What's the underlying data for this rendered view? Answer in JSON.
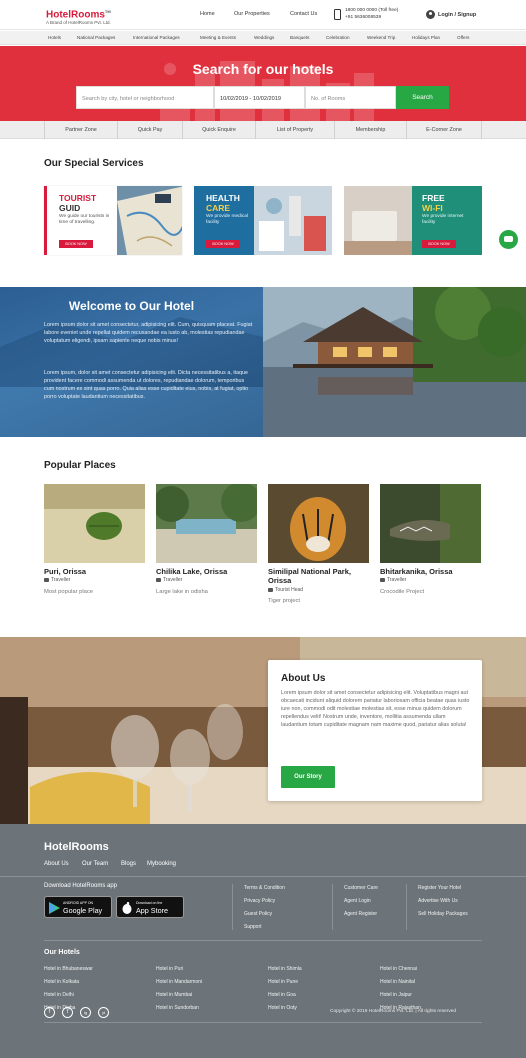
{
  "header": {
    "logo_title": "HotelRooms",
    "logo_tm": "TM",
    "logo_sub": "A Brand of HotelRooms Pvt. Ltd.",
    "nav": [
      "Home",
      "Our Properties",
      "Contact Us"
    ],
    "phone_line1": "1800 000 0000 (Toll free)",
    "phone_line2": "+91 5636008539",
    "login": "Login / Signup"
  },
  "subnav": [
    "Hotels",
    "National Packages",
    "International Packages",
    "Meeting & Events",
    "Weddings",
    "Banquets",
    "Celebration",
    "Weekend Trip",
    "Holidays Plan",
    "Offers"
  ],
  "hero": {
    "title": "Search for our hotels",
    "search_placeholder": "Search by city, hotel or neighborhood",
    "dates": "10/02/2019 - 10/02/2019",
    "rooms_placeholder": "No. of Rooms",
    "search_button": "Search",
    "accent": "#e0303e"
  },
  "quick_links": [
    "Partner Zone",
    "Quick Pay",
    "Quick Enquire",
    "List of Property",
    "Membership",
    "E-Corner Zone"
  ],
  "services": {
    "title": "Our Special Services",
    "cards": [
      {
        "title1": "TOURIST",
        "title2": "GUID",
        "desc": "We guide our tourists in time of travelling.",
        "button": "BOOK NOW"
      },
      {
        "title1": "HEALTH",
        "title2": "CARE",
        "desc": "We provide medical facility",
        "button": "BOOK NOW"
      },
      {
        "title1": "FREE",
        "title2": "WI-FI",
        "desc": "We provide internet facility",
        "button": "BOOK NOW"
      }
    ]
  },
  "welcome": {
    "title": "Welcome to Our Hotel",
    "para1": "Lorem ipsum dolor sit amet consectetur, adipisicing elit. Cum, quisquam placeat. Fugiat labore eveniet unde repellat quidem recusandae ea iusto ab, molestias repudiandae voluptatum eligendi, ipsam sapiente neque nobis minus!",
    "para2": "Lorem ipsum, dolor sit amet consectetur adipisicing elit. Dicta necessitatibus a, itaque provident facere commodi assumenda ut dolores, repudiandae dolorum, temporibus cum nostrum ex sint quas porro. Quia alias esse cupiditate eius, nobis, at fugiat, optio porro voluptate laudantium necessitatibus."
  },
  "places": {
    "title": "Popular Places",
    "items": [
      {
        "name": "Puri, Orissa",
        "type": "Traveller",
        "desc": "Most popular place"
      },
      {
        "name": "Chilika Lake, Orissa",
        "type": "Traveller",
        "desc": "Large lake in odisha"
      },
      {
        "name": "Similipal National Park, Orissa",
        "type": "Tourist Head",
        "desc": "Tiger project"
      },
      {
        "name": "Bhitarkanika, Orissa",
        "type": "Traveller",
        "desc": "Crocodile Project"
      }
    ]
  },
  "about": {
    "title": "About Us",
    "text": "Lorem ipsum dolor sit amet consectetur adipisicing elit. Voluptatibus magni aut obcaecati incidunt aliquid dolorem pariatur laboriosam officia beatae quas iusto iure non, commodi odit molestiae molestias sit, esse minus quidem dolorum repellendus velit! Nostrum unde, inventore, mollitia assumenda ullam laudantium totam cupiditate magnam nam maxime quod, pariatur alias soluta!",
    "button": "Our Story"
  },
  "footer": {
    "brand": "HotelRooms",
    "links": [
      "About Us",
      "Our Team",
      "Blogs",
      "Mybooking"
    ],
    "app_label": "Download HotelRooms app",
    "google_small": "ANDROID APP ON",
    "google_big": "Google Play",
    "apple_small": "Download on the",
    "apple_big": "App Store",
    "col1": [
      "Terms & Condition",
      "Privacy Policy",
      "Guest Policy",
      "Support"
    ],
    "col2": [
      "Customer Care",
      "Agent Login",
      "Agent Register"
    ],
    "col3": [
      "Register Your Hotel",
      "Advertise With Us",
      "Sell Holiday Packages"
    ],
    "hotels_title": "Our Hotels",
    "hotels": [
      [
        "Hotel in Bhubaneswar",
        "Hotel in Kolkata",
        "Hotel in Delhi",
        "Hotel in Digha"
      ],
      [
        "Hotel in Puri",
        "Hotel in Mandarmoni",
        "Hotel in Mumbai",
        "Hotel in Sundorban"
      ],
      [
        "Hotel in Shimla",
        "Hotel in Pune",
        "Hotel in Goa",
        "Hotel in Ooty"
      ],
      [
        "Hotel in Chennai",
        "Hotel in Nainital",
        "Hotel in Jaipur",
        "Hotel in Rajasthan"
      ]
    ],
    "social": [
      "f",
      "t",
      "ig",
      "yt"
    ],
    "copyright": "Copyright © 2019 HotelRooms Pvt. Ltd.  |  All rights reserved"
  }
}
